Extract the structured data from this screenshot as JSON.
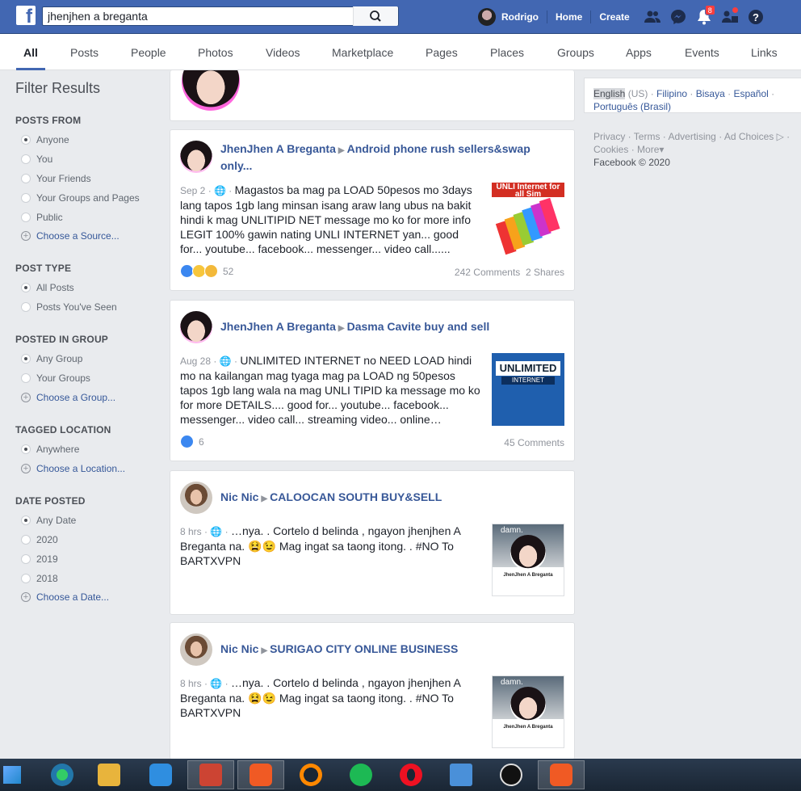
{
  "search": {
    "query": "jhenjhen a breganta"
  },
  "header": {
    "user": "Rodrigo",
    "home": "Home",
    "create": "Create",
    "notifications_count": "8"
  },
  "tabs": [
    "All",
    "Posts",
    "People",
    "Photos",
    "Videos",
    "Marketplace",
    "Pages",
    "Places",
    "Groups",
    "Apps",
    "Events",
    "Links"
  ],
  "filters": {
    "title": "Filter Results",
    "posts_from": {
      "label": "POSTS FROM",
      "options": [
        "Anyone",
        "You",
        "Your Friends",
        "Your Groups and Pages",
        "Public"
      ],
      "choose": "Choose a Source..."
    },
    "post_type": {
      "label": "POST TYPE",
      "options": [
        "All Posts",
        "Posts You've Seen"
      ]
    },
    "posted_in_group": {
      "label": "POSTED IN GROUP",
      "options": [
        "Any Group",
        "Your Groups"
      ],
      "choose": "Choose a Group..."
    },
    "tagged_location": {
      "label": "TAGGED LOCATION",
      "options": [
        "Anywhere"
      ],
      "choose": "Choose a Location..."
    },
    "date_posted": {
      "label": "DATE POSTED",
      "options": [
        "Any Date",
        "2020",
        "2019",
        "2018"
      ],
      "choose": "Choose a Date..."
    }
  },
  "posts": [
    {
      "author": "JhenJhen A Breganta",
      "group": "Android phone rush sellers&swap only...",
      "date": "Sep 2",
      "text": "Magastos ba mag pa LOAD 50pesos mo 3days lang tapos 1gb lang minsan isang araw lang ubus na bakit hindi k mag UNLITIPID NET message mo ko for more info LEGIT 100% gawin nating UNLI INTERNET yan... good for... youtube... facebook... messenger... video call......",
      "reactions": "52",
      "comments": "242 Comments",
      "shares": "2 Shares",
      "thumb_text": "UNLI Internet for all Sim"
    },
    {
      "author": "JhenJhen A Breganta",
      "group": "Dasma Cavite buy and sell",
      "date": "Aug 28",
      "text": "UNLIMITED INTERNET no NEED LOAD hindi mo na kailangan mag tyaga mag pa LOAD ng 50pesos tapos 1gb lang wala na mag UNLI TIPID ka message mo ko for more DETAILS.... good for... youtube... facebook... messenger... video call... streaming video... online…",
      "reactions": "6",
      "comments": "45 Comments",
      "thumb_text": "UNLIMITED",
      "thumb_sub": "INTERNET"
    },
    {
      "author": "Nic Nic",
      "group": "CALOOCAN SOUTH BUY&SELL",
      "date": "8 hrs",
      "text": "…nya. . Cortelo d belinda , ngayon jhenjhen A Breganta na. 😫😉 Mag ingat sa taong itong. . #NO To BARTXVPN",
      "thumb_text": "damn.",
      "thumb_name": "JhenJhen A Breganta"
    },
    {
      "author": "Nic Nic",
      "group": "SURIGAO CITY ONLINE BUSINESS",
      "date": "8 hrs",
      "text": "…nya. . Cortelo d belinda , ngayon jhenjhen A Breganta na. 😫😉 Mag ingat sa taong itong. . #NO To BARTXVPN",
      "thumb_text": "damn.",
      "thumb_name": "JhenJhen A Breganta"
    }
  ],
  "languages": {
    "current": "English",
    "current_region": "(US)",
    "others": [
      "Filipino",
      "Bisaya",
      "Español",
      "Português (Brasil)"
    ]
  },
  "footer": {
    "links": [
      "Privacy",
      "Terms",
      "Advertising",
      "Ad Choices",
      "Cookies",
      "More"
    ],
    "copyright": "Facebook © 2020"
  },
  "colors": {
    "brand": "#4267b2",
    "link": "#385898",
    "background": "#e9ebee"
  }
}
